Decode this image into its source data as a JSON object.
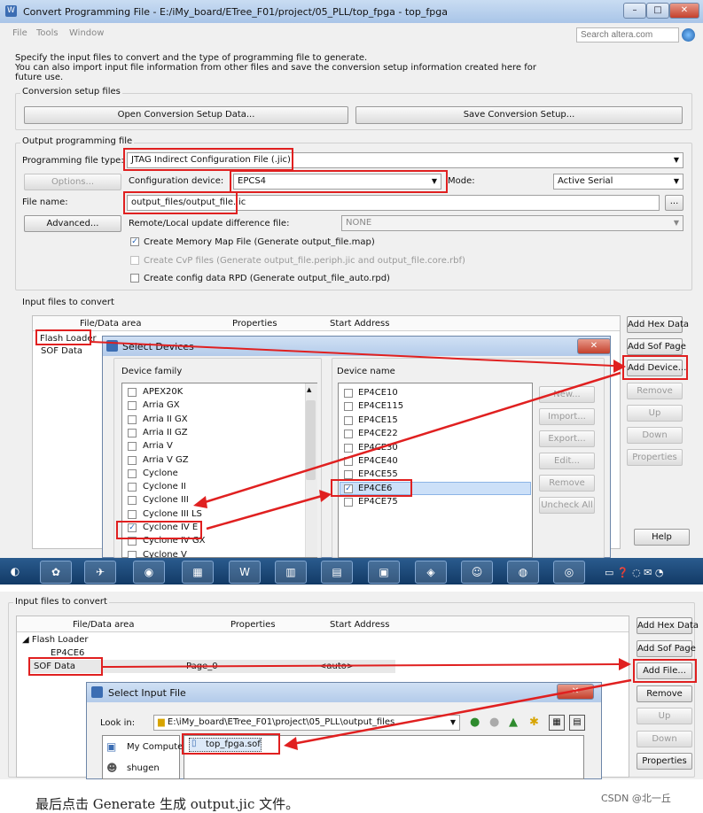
{
  "window": {
    "title": "Convert Programming File - E:/iMy_board/ETree_F01/project/05_PLL/top_fpga - top_fpga",
    "min": "–",
    "max": "□",
    "close": "✕"
  },
  "menu": {
    "file": "File",
    "tools": "Tools",
    "window": "Window",
    "search_placeholder": "Search altera.com"
  },
  "intro": {
    "line1": "Specify the input files to convert and the type of programming file to generate.",
    "line2": "You can also import input file information from other files and save the conversion setup information created here for",
    "line3": "future use."
  },
  "setup": {
    "group": "Conversion setup files",
    "open": "Open Conversion Setup Data...",
    "save": "Save Conversion Setup..."
  },
  "output": {
    "group": "Output programming file",
    "type_label": "Programming file type:",
    "type_value": "JTAG Indirect Configuration File (.jic)",
    "options": "Options...",
    "device_label": "Configuration device:",
    "device_value": "EPCS4",
    "mode_label": "Mode:",
    "mode_value": "Active Serial",
    "filename_label": "File name:",
    "filename_value": "output_files/output_file.jic",
    "browse": "...",
    "advanced": "Advanced...",
    "remote_label": "Remote/Local update difference file:",
    "remote_value": "NONE",
    "cb_map": "Create Memory Map File (Generate output_file.map)",
    "cb_cvp": "Create CvP files (Generate output_file.periph.jic and output_file.core.rbf)",
    "cb_rpd": "Create config data RPD (Generate output_file_auto.rpd)"
  },
  "input": {
    "group": "Input files to convert",
    "columns": [
      "File/Data area",
      "Properties",
      "Start Address"
    ],
    "rows": [
      "Flash Loader",
      "SOF Data"
    ],
    "buttons": {
      "add_hex": "Add Hex Data",
      "add_sof": "Add Sof Page",
      "add_device": "Add Device...",
      "remove": "Remove",
      "up": "Up",
      "down": "Down",
      "properties": "Properties"
    },
    "help": "Help"
  },
  "select_devices": {
    "title": "Select Devices",
    "family_label": "Device family",
    "families": [
      {
        "name": "APEX20K",
        "checked": false
      },
      {
        "name": "Arria GX",
        "checked": false
      },
      {
        "name": "Arria II GX",
        "checked": false
      },
      {
        "name": "Arria II GZ",
        "checked": false
      },
      {
        "name": "Arria V",
        "checked": false
      },
      {
        "name": "Arria V GZ",
        "checked": false
      },
      {
        "name": "Cyclone",
        "checked": false
      },
      {
        "name": "Cyclone II",
        "checked": false
      },
      {
        "name": "Cyclone III",
        "checked": false
      },
      {
        "name": "Cyclone III LS",
        "checked": false
      },
      {
        "name": "Cyclone IV E",
        "checked": true
      },
      {
        "name": "Cyclone IV GX",
        "checked": false
      },
      {
        "name": "Cyclone V",
        "checked": false
      }
    ],
    "name_label": "Device name",
    "devices": [
      {
        "name": "EP4CE10",
        "checked": false
      },
      {
        "name": "EP4CE115",
        "checked": false
      },
      {
        "name": "EP4CE15",
        "checked": false
      },
      {
        "name": "EP4CE22",
        "checked": false
      },
      {
        "name": "EP4CE30",
        "checked": false
      },
      {
        "name": "EP4CE40",
        "checked": false
      },
      {
        "name": "EP4CE55",
        "checked": false
      },
      {
        "name": "EP4CE6",
        "checked": true
      },
      {
        "name": "EP4CE75",
        "checked": false
      }
    ],
    "buttons": {
      "new": "New...",
      "import": "Import...",
      "export": "Export...",
      "edit": "Edit...",
      "remove": "Remove",
      "uncheck": "Uncheck All"
    }
  },
  "panel2": {
    "group": "Input files to convert",
    "columns": [
      "File/Data area",
      "Properties",
      "Start Address"
    ],
    "tree": {
      "flash_loader": "Flash Loader",
      "device": "EP4CE6",
      "sof": "SOF Data",
      "page": "Page_0",
      "addr": "<auto>"
    },
    "buttons": {
      "add_hex": "Add Hex Data",
      "add_sof": "Add Sof Page",
      "add_file": "Add File...",
      "remove": "Remove",
      "up": "Up",
      "down": "Down",
      "properties": "Properties"
    },
    "dialog": {
      "title": "Select Input File",
      "lookin_label": "Look in:",
      "lookin_value": "E:\\iMy_board\\ETree_F01\\project\\05_PLL\\output_files",
      "places": [
        "My Computer",
        "shugen"
      ],
      "file": "top_fpga.sof"
    }
  },
  "caption": "最后点击 Generate 生成 output.jic 文件。",
  "watermark": "CSDN @北一丘",
  "colors": {
    "annotation": "#e02020",
    "titlebar": "#b3cbea",
    "selection": "#cce0f8"
  }
}
